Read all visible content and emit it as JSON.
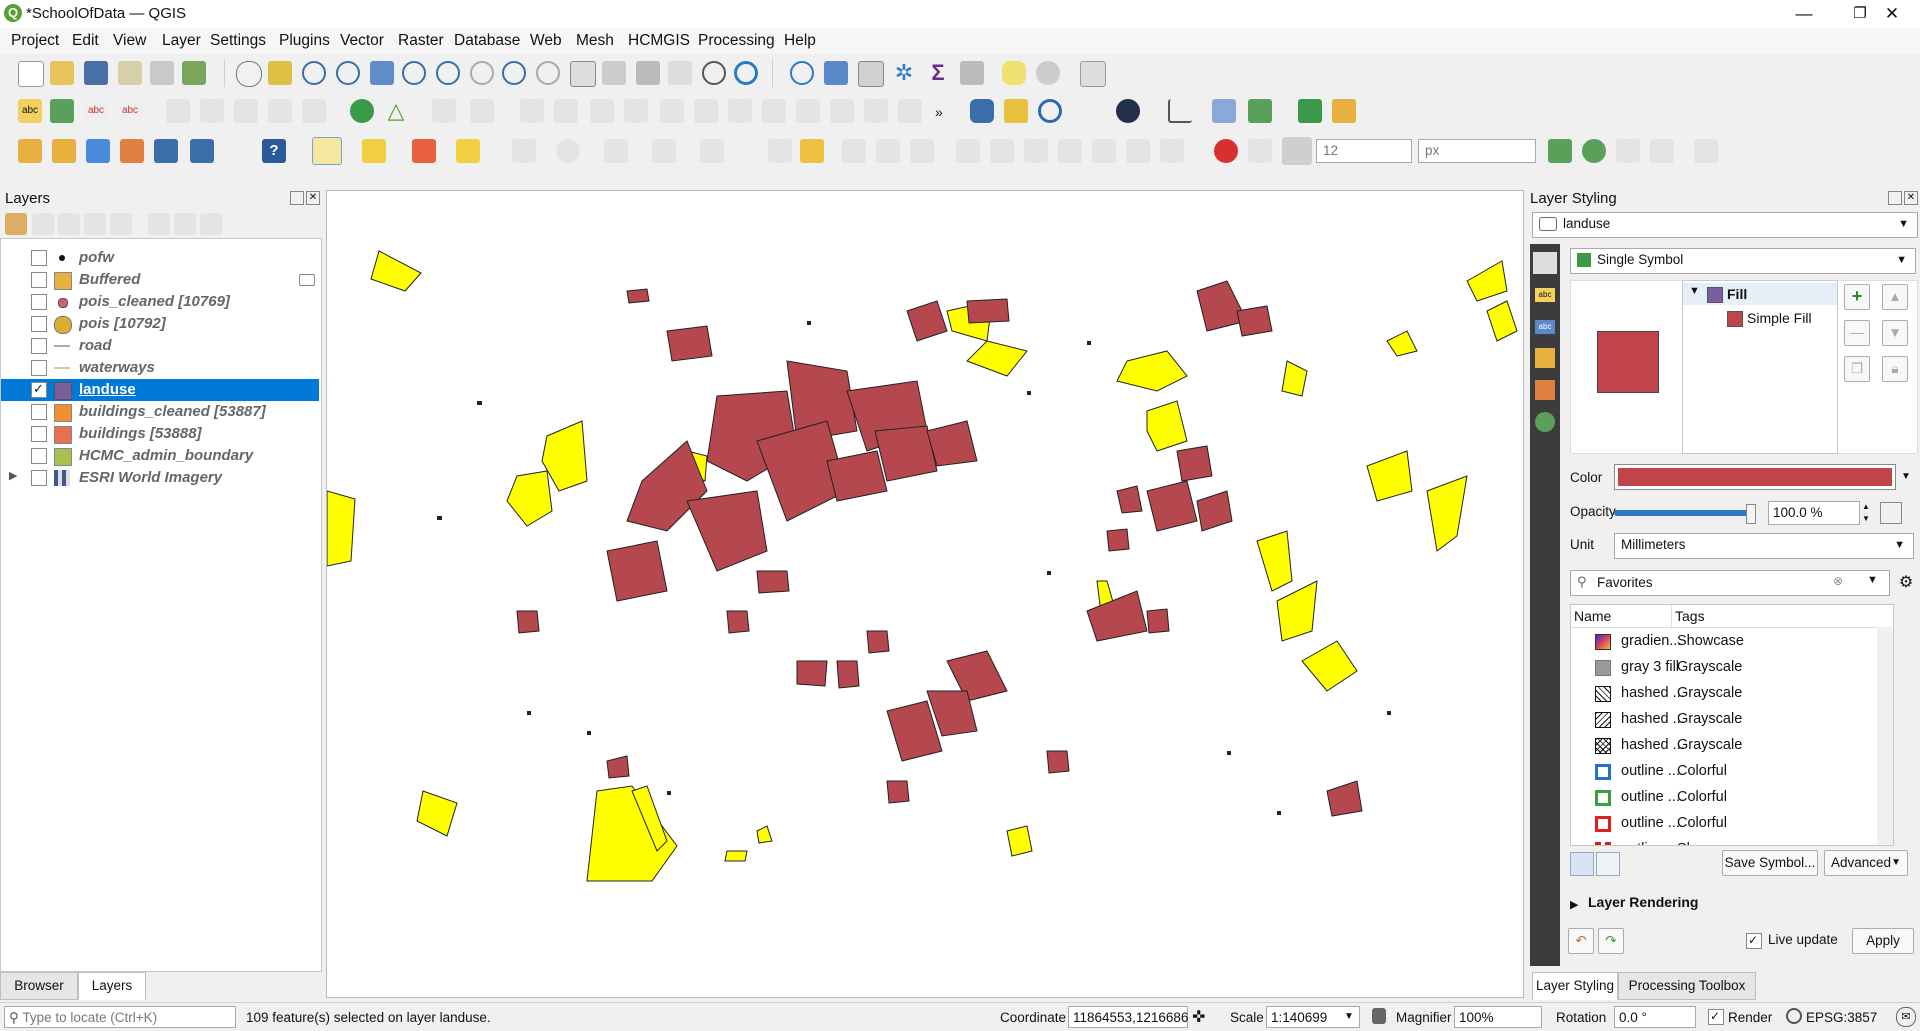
{
  "window": {
    "title": "*SchoolOfData — QGIS",
    "minimize_glyph": "—",
    "restore_glyph": "❐",
    "close_glyph": "✕"
  },
  "menu": [
    "Project",
    "Edit",
    "View",
    "Layer",
    "Settings",
    "Plugins",
    "Vector",
    "Raster",
    "Database",
    "Web",
    "Mesh",
    "HCMGIS",
    "Processing",
    "Help"
  ],
  "toolbar": {
    "size_value": "12",
    "unit_value": "px"
  },
  "layers_panel": {
    "title": "Layers",
    "layers": [
      {
        "name": "pofw",
        "checked": false,
        "symbol": "point-black"
      },
      {
        "name": "Buffered",
        "checked": false,
        "symbol": "fill-orange"
      },
      {
        "name": "pois_cleaned [10769]",
        "checked": false,
        "symbol": "point-red"
      },
      {
        "name": "pois [10792]",
        "checked": false,
        "symbol": "circle-gold"
      },
      {
        "name": "road",
        "checked": false,
        "symbol": "line-gray"
      },
      {
        "name": "waterways",
        "checked": false,
        "symbol": "line-tan"
      },
      {
        "name": "landuse",
        "checked": true,
        "symbol": "fill-purple",
        "selected": true
      },
      {
        "name": "buildings_cleaned [53887]",
        "checked": false,
        "symbol": "fill-orange2"
      },
      {
        "name": "buildings [53888]",
        "checked": false,
        "symbol": "fill-salmon"
      },
      {
        "name": "HCMC_admin_boundary",
        "checked": false,
        "symbol": "fill-olive"
      },
      {
        "name": "ESRI World Imagery",
        "checked": false,
        "symbol": "raster"
      }
    ],
    "tabs": [
      "Browser",
      "Layers"
    ]
  },
  "styling_panel": {
    "title": "Layer Styling",
    "layer_select": "landuse",
    "renderer": "Single Symbol",
    "tree_fill": "Fill",
    "tree_simple_fill": "Simple Fill",
    "color_label": "Color",
    "opacity_label": "Opacity",
    "opacity_value": "100.0 %",
    "opacity_level": 1.0,
    "unit_label": "Unit",
    "unit_value": "Millimeters",
    "search_value": "Favorites",
    "col_name": "Name",
    "col_tags": "Tags",
    "symbols": [
      {
        "name": "gradien...",
        "tag": "Showcase",
        "swatch": "gradient"
      },
      {
        "name": "gray 3 fill",
        "tag": "Grayscale",
        "swatch": "gray"
      },
      {
        "name": "hashed ...",
        "tag": "Grayscale",
        "swatch": "hash1"
      },
      {
        "name": "hashed ...",
        "tag": "Grayscale",
        "swatch": "hash2"
      },
      {
        "name": "hashed ...",
        "tag": "Grayscale",
        "swatch": "hash3"
      },
      {
        "name": "outline ...",
        "tag": "Colorful",
        "swatch": "blue"
      },
      {
        "name": "outline ...",
        "tag": "Colorful",
        "swatch": "green"
      },
      {
        "name": "outline ...",
        "tag": "Colorful",
        "swatch": "red"
      },
      {
        "name": "outline ...",
        "tag": "Showcase",
        "swatch": "redshow"
      }
    ],
    "save_symbol": "Save Symbol...",
    "advanced": "Advanced",
    "layer_rendering": "Layer Rendering",
    "live_update": "Live update",
    "apply": "Apply",
    "tabs": [
      "Layer Styling",
      "Processing Toolbox"
    ]
  },
  "status": {
    "locate_placeholder": "Type to locate (Ctrl+K)",
    "message": "109 feature(s) selected on layer landuse.",
    "coordinate_label": "Coordinate",
    "coordinate_value": "11864553,1216686",
    "scale_label": "Scale",
    "scale_value": "1:140699",
    "magnifier_label": "Magnifier",
    "magnifier_value": "100%",
    "rotation_label": "Rotation",
    "rotation_value": "0.0 °",
    "render_label": "Render",
    "crs": "EPSG:3857"
  },
  "colors": {
    "landuse_fill": "#b5484e",
    "highlight_fill": "#ffff00",
    "selection_blue": "#0078d7",
    "symbol_color": "#c0444a"
  }
}
